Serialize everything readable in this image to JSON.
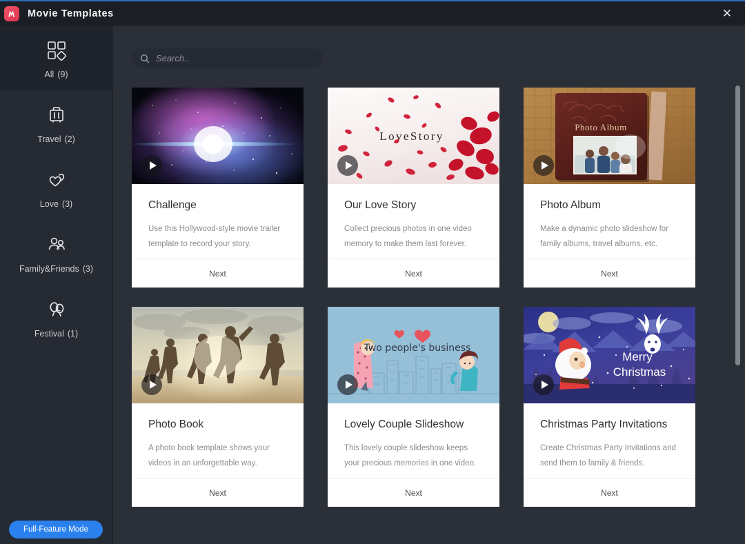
{
  "window": {
    "title": "Movie Templates",
    "app_icon": "filmora-app-icon",
    "close_label": "✕"
  },
  "sidebar": {
    "items": [
      {
        "label": "All",
        "count": "(9)",
        "icon": "grid-shapes-icon",
        "selected": true
      },
      {
        "label": "Travel",
        "count": "(2)",
        "icon": "suitcase-icon",
        "selected": false
      },
      {
        "label": "Love",
        "count": "(3)",
        "icon": "two-hearts-icon",
        "selected": false
      },
      {
        "label": "Family&Friends",
        "count": "(3)",
        "icon": "two-people-icon",
        "selected": false
      },
      {
        "label": "Festival",
        "count": "(1)",
        "icon": "balloons-icon",
        "selected": false
      }
    ],
    "mode_button": "Full-Feature Mode"
  },
  "search": {
    "placeholder": "Search..",
    "value": "",
    "icon": "search-icon"
  },
  "colors": {
    "accent_blue": "#2a81ee",
    "titlebar_bg": "#1b1e24",
    "sidebar_bg": "#262a33",
    "content_bg": "#2b2f38",
    "card_bg": "#ffffff"
  },
  "templates": [
    {
      "title": "Challenge",
      "description": "Use this Hollywood-style movie trailer template to record your story.",
      "action": "Next",
      "thumb": "space-nebula-thumbnail",
      "thumb_caption": ""
    },
    {
      "title": "Our Love Story",
      "description": "Collect precious photos in one video memory to make them last forever.",
      "action": "Next",
      "thumb": "rose-petals-thumbnail",
      "thumb_caption": "LoveStory"
    },
    {
      "title": "Photo Album",
      "description": "Make a dynamic photo slideshow for family albums, travel albums, etc.",
      "action": "Next",
      "thumb": "leather-photo-album-thumbnail",
      "thumb_caption": "Photo Album"
    },
    {
      "title": "Photo Book",
      "description": "A photo book template shows your videos in an unforgettable way.",
      "action": "Next",
      "thumb": "beach-runners-thumbnail",
      "thumb_caption": ""
    },
    {
      "title": "Lovely Couple Slideshow",
      "description": "This lovely couple slideshow keeps your precious memories in one video.",
      "action": "Next",
      "thumb": "cartoon-couple-city-thumbnail",
      "thumb_caption": "Two people's business"
    },
    {
      "title": "Christmas Party Invitations",
      "description": "Create Christmas Party Invitations and send them to family & friends.",
      "action": "Next",
      "thumb": "santa-christmas-thumbnail",
      "thumb_caption": "Merry Christmas"
    }
  ]
}
